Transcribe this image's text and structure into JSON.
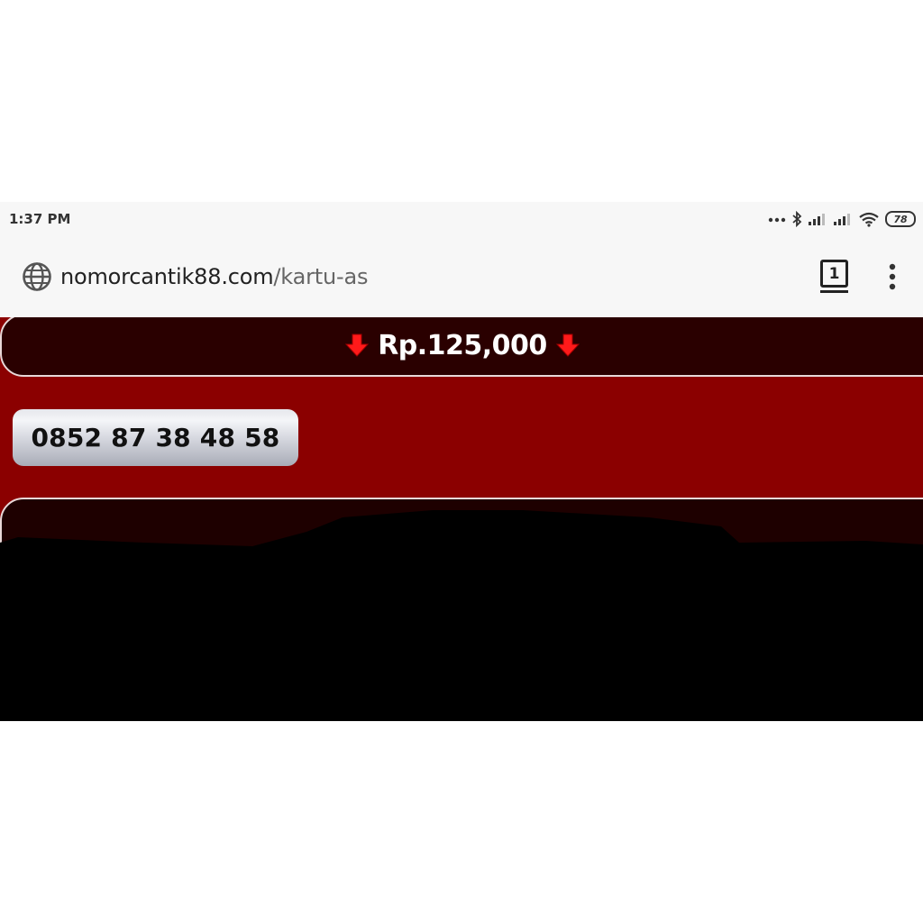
{
  "status_bar": {
    "time": "1:37 PM",
    "battery": "78",
    "icons": [
      "more-dots-icon",
      "bluetooth-icon",
      "signal-icon",
      "signal-icon",
      "wifi-icon",
      "battery-icon"
    ]
  },
  "browser": {
    "url_domain": "nomorcantik88.com",
    "url_path": "/kartu-as",
    "tab_count": "1"
  },
  "listing": {
    "price": "Rp.125,000",
    "phone_number": "0852 87 38 48 58"
  },
  "colors": {
    "page_background": "#8b0000",
    "price_bar": "#2a0000",
    "arrow": "#ff1a1a",
    "browser_chrome": "#f7f7f7"
  }
}
